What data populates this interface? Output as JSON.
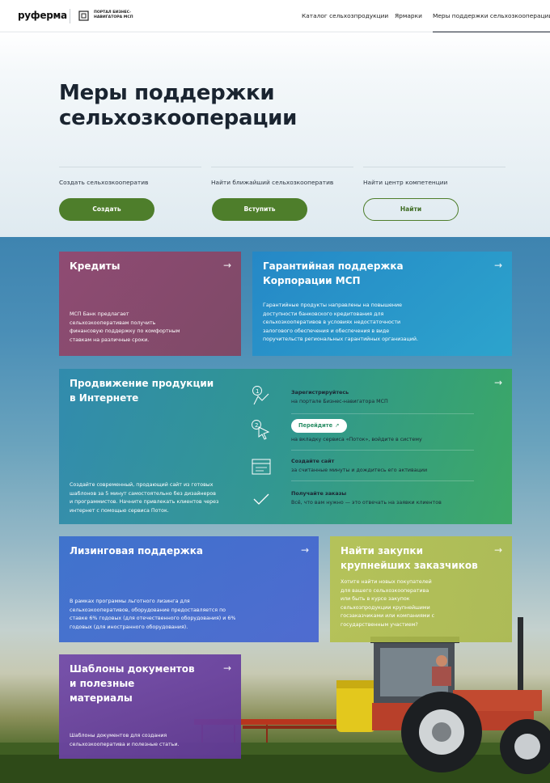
{
  "header": {
    "logo": "руферма",
    "portal_line1": "ПОРТАЛ БИЗНЕС-",
    "portal_line2": "НАВИГАТОРА МСП",
    "nav": [
      {
        "label": "Каталог сельхозпродукции"
      },
      {
        "label": "Ярмарки"
      },
      {
        "label": "Меры поддержки сельхозкооперации",
        "active": true
      }
    ]
  },
  "hero": {
    "title_line1": "Меры поддержки",
    "title_line2": "сельхозкооперации",
    "actions": [
      {
        "label": "Создать сельхозкооператив",
        "button": "Создать"
      },
      {
        "label": "Найти ближайший сельхозкооператив",
        "button": "Вступить"
      },
      {
        "label": "Найти центр компетенции",
        "button": "Найти"
      }
    ]
  },
  "cards": {
    "credits": {
      "title": "Кредиты",
      "arrow": "→",
      "desc": [
        "МСП Банк предлагает",
        "сельхозкооперативам получить",
        "финансовую поддержку по комфортным",
        "ставкам на различные сроки."
      ]
    },
    "guarantee": {
      "title_line1": "Гарантийная поддержка",
      "title_line2": "Корпорации МСП",
      "arrow": "→",
      "desc": [
        "Гарантийные продукты направлены на повышение",
        "доступности банковского кредитования для",
        "сельхозкооперативов в условиях недостаточности",
        "залогового обеспечения и обеспечения в виде",
        "поручительств региональных гарантийных организаций."
      ]
    },
    "promotion": {
      "title_line1": "Продвижение продукции",
      "title_line2": "в Интернете",
      "arrow": "→",
      "desc": [
        "Создайте современный, продающий сайт из готовых",
        "шаблонов за 5 минут самостоятельно без дизайнеров",
        "и программистов. Начните привлекать клиентов через",
        "интернет с помощью сервиса Поток."
      ],
      "steps": [
        {
          "title": "Зарегистрируйтесь",
          "text": "на портале Бизнес-навигатора МСП"
        },
        {
          "button": "Перейдите",
          "button_icon": "↗",
          "text": "на вкладку сервиса «Поток», войдите в систему"
        },
        {
          "title": "Создайте сайт",
          "text": "за считанные минуты и дождитесь его активации"
        },
        {
          "title": "Получайте заказы",
          "text": "Всё, что вам нужно — это отвечать на заявки клиентов"
        }
      ]
    },
    "leasing": {
      "title": "Лизинговая поддержка",
      "arrow": "→",
      "desc": [
        "В рамках программы льготного лизинга для",
        "сельхозкооперативов, оборудование предоставляется по",
        "ставке 6% годовых (для отечественного оборудования) и 6%",
        "годовых (для иностранного оборудования)."
      ]
    },
    "procurement": {
      "title_line1": "Найти закупки",
      "title_line2": "крупнейших заказчиков",
      "arrow": "→",
      "desc": [
        "Хотите найти новых покупателей",
        "для вашего сельхозкооператива",
        "или быть в курсе закупок",
        "сельхозпродукции крупнейшими",
        "госзаказчиками или компаниями с",
        "государственным участием?"
      ]
    },
    "templates": {
      "title_line1": "Шаблоны документов",
      "title_line2": "и полезные",
      "title_line3": "материалы",
      "arrow": "→",
      "desc": [
        "Шаблоны документов для создания",
        "сельхозкооператива и полезные статьи."
      ]
    }
  },
  "colors": {
    "accent_green": "#4e7e2b",
    "credits": "#96466e",
    "guarantee": "#2388c8",
    "promotion": "#38a860",
    "leasing": "#396ecd",
    "procurement": "#b8c44e",
    "templates": "#7048a8"
  }
}
